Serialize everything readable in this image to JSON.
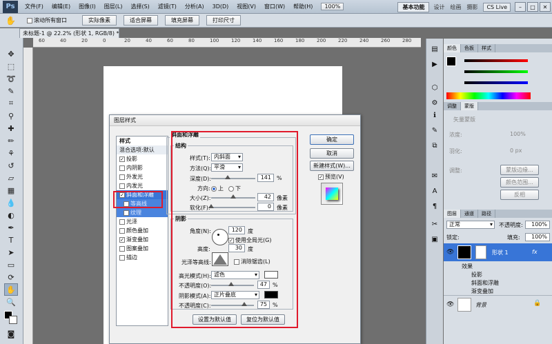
{
  "app": {
    "logo": "Ps",
    "menu": [
      "文件(F)",
      "编辑(E)",
      "图像(I)",
      "图层(L)",
      "选择(S)",
      "滤镜(T)",
      "分析(A)",
      "3D(D)",
      "视图(V)",
      "窗口(W)",
      "帮助(H)"
    ],
    "zoom_value": "100%",
    "workspace_active": "基本功能",
    "workspace_links": [
      "设计",
      "绘画",
      "摄影"
    ],
    "cs_live": "CS Live"
  },
  "options_bar": {
    "scroll_all_label": "滚动所有窗口",
    "buttons": [
      "实际像素",
      "适合屏幕",
      "填充屏幕",
      "打印尺寸"
    ]
  },
  "document": {
    "tab_title": "未标题-1 @ 22.2% (形状 1, RGB/8) *",
    "ruler_ticks": [
      "60",
      "40",
      "20",
      "0",
      "20",
      "40",
      "60",
      "80",
      "100",
      "120",
      "140",
      "160",
      "180",
      "200",
      "220",
      "240",
      "260",
      "280"
    ]
  },
  "dialog": {
    "title": "图层样式",
    "style_list": {
      "header": "样式",
      "blend": "混合选项:默认",
      "items": [
        {
          "label": "投影",
          "checked": true
        },
        {
          "label": "内阴影",
          "checked": false
        },
        {
          "label": "外发光",
          "checked": false
        },
        {
          "label": "内发光",
          "checked": false
        },
        {
          "label": "斜面和浮雕",
          "checked": true,
          "selected": true
        },
        {
          "label": "等高线",
          "checked": false,
          "sub": true
        },
        {
          "label": "纹理",
          "checked": false,
          "sub": true
        },
        {
          "label": "光泽",
          "checked": false
        },
        {
          "label": "颜色叠加",
          "checked": false
        },
        {
          "label": "渐变叠加",
          "checked": true
        },
        {
          "label": "图案叠加",
          "checked": false
        },
        {
          "label": "描边",
          "checked": false
        }
      ]
    },
    "bevel": {
      "section_title": "斜面和浮雕",
      "structure_title": "结构",
      "style_label": "样式(T):",
      "style_value": "内斜面",
      "technique_label": "方法(Q):",
      "technique_value": "平滑",
      "depth_label": "深度(D):",
      "depth_value": "141",
      "depth_unit": "%",
      "direction_label": "方向:",
      "direction_up": "上",
      "direction_down": "下",
      "size_label": "大小(Z):",
      "size_value": "42",
      "size_unit": "像素",
      "soften_label": "软化(F):",
      "soften_value": "0",
      "soften_unit": "像素"
    },
    "shading": {
      "title": "阴影",
      "angle_label": "角度(N):",
      "angle_value": "120",
      "angle_unit": "度",
      "global_light": "使用全局光(G)",
      "altitude_label": "高度:",
      "altitude_value": "30",
      "altitude_unit": "度",
      "gloss_label": "光泽等高线:",
      "anti_alias": "消除锯齿(L)",
      "highlight_mode_label": "高光模式(H):",
      "highlight_mode_value": "滤色",
      "highlight_opacity_label": "不透明度(O):",
      "highlight_opacity_value": "47",
      "shadow_mode_label": "阴影模式(A):",
      "shadow_mode_value": "正片叠底",
      "shadow_opacity_label": "不透明度(C):",
      "shadow_opacity_value": "75",
      "percent": "%"
    },
    "buttons": {
      "make_default": "设置为默认值",
      "reset_default": "复位为默认值",
      "ok": "确定",
      "cancel": "取消",
      "new_style": "新建样式(W)...",
      "preview": "预览(V)"
    }
  },
  "panels": {
    "color_tabs": [
      "颜色",
      "色板",
      "样式"
    ],
    "adjust_tabs": [
      "调整",
      "蒙版"
    ],
    "mask_label": "矢量蒙版",
    "density_label": "浓度:",
    "density_value": "100%",
    "feather_label": "羽化:",
    "feather_value": "0 px",
    "edge_label": "调整:",
    "mask_edge": "蒙版边缘...",
    "color_range": "颜色范围...",
    "invert": "反相",
    "layers_tabs": [
      "图层",
      "通道",
      "路径"
    ],
    "blend_mode": "正常",
    "opacity_label": "不透明度:",
    "opacity_value": "100%",
    "lock_label": "锁定:",
    "fill_label": "填充:",
    "fill_value": "100%",
    "layers": {
      "shape_name": "形状 1",
      "effects_label": "效果",
      "effect_items": [
        "投影",
        "斜面和浮雕",
        "渐变叠加"
      ],
      "background_name": "背景",
      "fx": "fx"
    }
  },
  "colors": {
    "highlight_red": "#e0192b",
    "selection_blue": "#3875d7"
  }
}
